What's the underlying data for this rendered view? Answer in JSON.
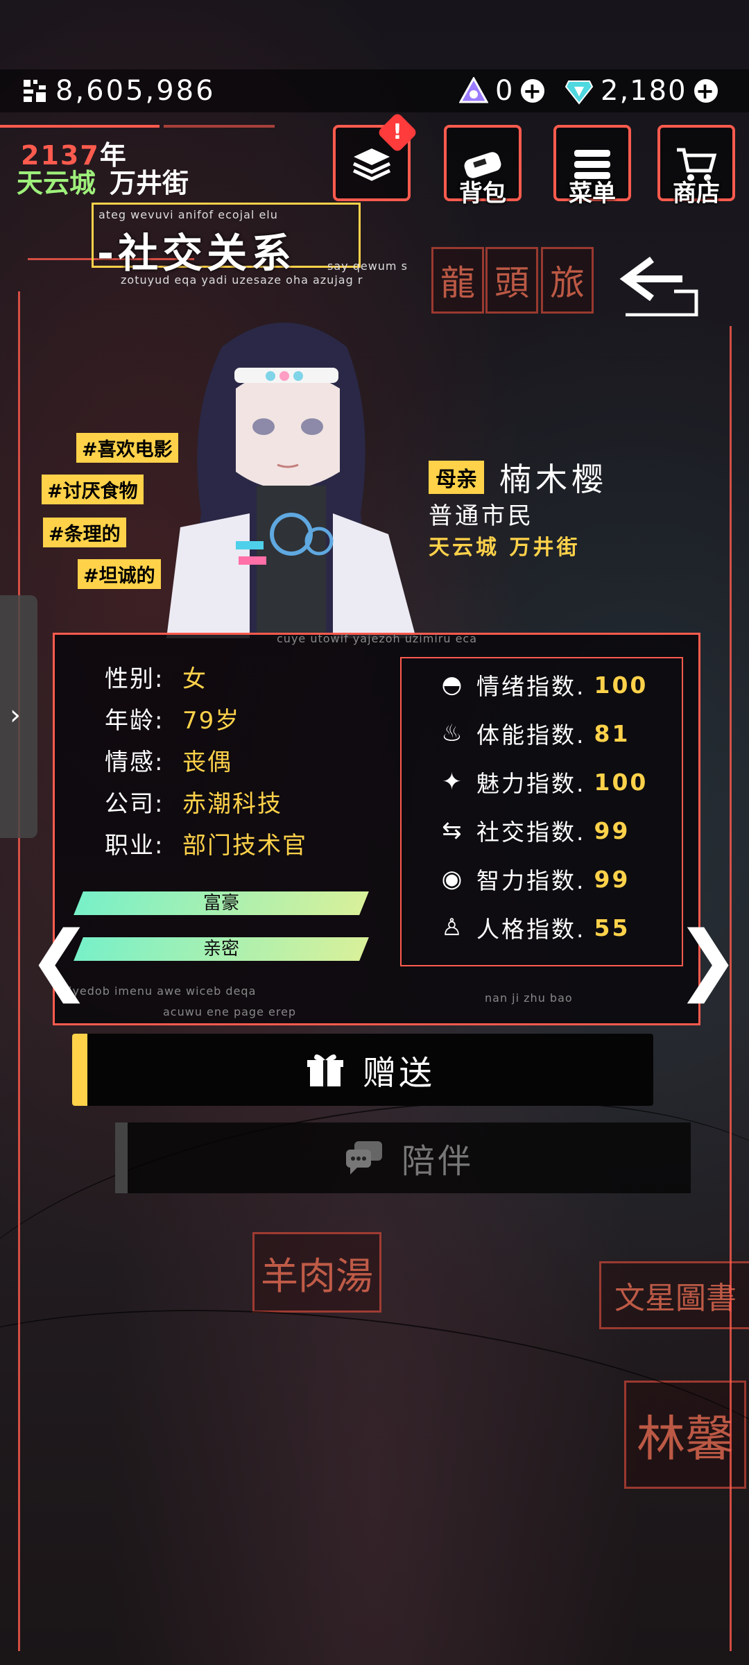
{
  "currency": {
    "coins": "8,605,986",
    "gems_a": "0",
    "gems_b": "2,180"
  },
  "world": {
    "year": "2137",
    "year_unit": "年",
    "city": "天云城",
    "street": "万井街"
  },
  "top_buttons": {
    "backpack": "背包",
    "menu": "菜单",
    "shop": "商店"
  },
  "page": {
    "title": "社交关系",
    "deco_1": "ateg wevuvi anifof ecojal elu",
    "deco_2": "zotuyud eqa yadi uzesaze oha azujag r",
    "deco_3": "say qewum s",
    "deco_4": "cuye utowif yajezoh uzimiru eca",
    "deco_5": "iyedob imenu awe wiceb deqa",
    "deco_6": "acuwu ene page erep",
    "deco_7": "nan ji zhu bao"
  },
  "tags": [
    "#喜欢电影",
    "#讨厌食物",
    "#条理的",
    "#坦诚的"
  ],
  "character": {
    "relation": "母亲",
    "name": "楠木樱",
    "job": "普通市民",
    "city": "天云城",
    "street": "万井街"
  },
  "profile": [
    {
      "label": "性别:",
      "value": "女"
    },
    {
      "label": "年龄:",
      "value": "79岁"
    },
    {
      "label": "情感:",
      "value": "丧偶"
    },
    {
      "label": "公司:",
      "value": "赤潮科技"
    },
    {
      "label": "职业:",
      "value": "部门技术官"
    }
  ],
  "bars": [
    "富豪",
    "亲密"
  ],
  "stats": [
    {
      "icon": "mood-icon",
      "label": "情绪指数.",
      "value": "100"
    },
    {
      "icon": "fitness-icon",
      "label": "体能指数.",
      "value": "81"
    },
    {
      "icon": "charm-icon",
      "label": "魅力指数.",
      "value": "100"
    },
    {
      "icon": "social-icon",
      "label": "社交指数.",
      "value": "99"
    },
    {
      "icon": "intellect-icon",
      "label": "智力指数.",
      "value": "99"
    },
    {
      "icon": "personality-icon",
      "label": "人格指数.",
      "value": "55"
    }
  ],
  "actions": {
    "give": "赠送",
    "accompany": "陪伴"
  },
  "background_signs": {
    "s1": "龍",
    "s2": "頭",
    "s3": "旅",
    "s4": "羊肉湯",
    "s5": "文星圖書",
    "s6": "林馨"
  },
  "colors": {
    "accent_red": "#ff5b4e",
    "accent_yellow": "#ffd24a",
    "city_green": "#9ef07b"
  }
}
